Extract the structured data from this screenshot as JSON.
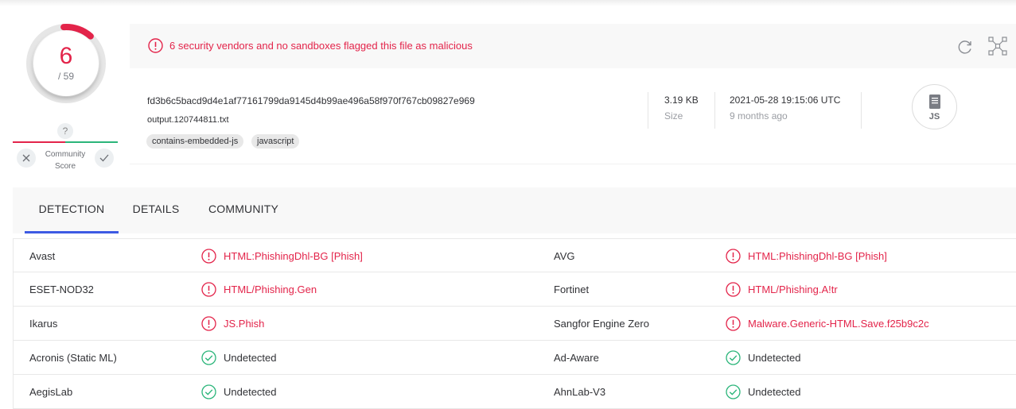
{
  "score": {
    "detections": "6",
    "total": "/ 59"
  },
  "community": {
    "question": "?",
    "label_line1": "Community",
    "label_line2": "Score"
  },
  "alert": {
    "text": "6 security vendors and no sandboxes flagged this file as malicious"
  },
  "file": {
    "hash": "fd3b6c5bacd9d4e1af77161799da9145d4b99ae496a58f970f767cb09827e969",
    "name": "output.120744811.txt",
    "tags": [
      "contains-embedded-js",
      "javascript"
    ],
    "size_value": "3.19 KB",
    "size_label": "Size",
    "date_value": "2021-05-28 19:15:06 UTC",
    "date_relative": "9 months ago",
    "type_label": "JS"
  },
  "tabs": [
    {
      "label": "DETECTION",
      "active": true
    },
    {
      "label": "DETAILS",
      "active": false
    },
    {
      "label": "COMMUNITY",
      "active": false
    }
  ],
  "detections": [
    {
      "left_engine": "Avast",
      "left_result": "HTML:PhishingDhl-BG [Phish]",
      "left_status": "malicious",
      "right_engine": "AVG",
      "right_result": "HTML:PhishingDhl-BG [Phish]",
      "right_status": "malicious"
    },
    {
      "left_engine": "ESET-NOD32",
      "left_result": "HTML/Phishing.Gen",
      "left_status": "malicious",
      "right_engine": "Fortinet",
      "right_result": "HTML/Phishing.A!tr",
      "right_status": "malicious"
    },
    {
      "left_engine": "Ikarus",
      "left_result": "JS.Phish",
      "left_status": "malicious",
      "right_engine": "Sangfor Engine Zero",
      "right_result": "Malware.Generic-HTML.Save.f25b9c2c",
      "right_status": "malicious"
    },
    {
      "left_engine": "Acronis (Static ML)",
      "left_result": "Undetected",
      "left_status": "undetected",
      "right_engine": "Ad-Aware",
      "right_result": "Undetected",
      "right_status": "undetected"
    },
    {
      "left_engine": "AegisLab",
      "left_result": "Undetected",
      "left_status": "undetected",
      "right_engine": "AhnLab-V3",
      "right_result": "Undetected",
      "right_status": "undetected"
    }
  ],
  "colors": {
    "malicious": "#e3244a",
    "clean": "#2bb57a",
    "accent": "#3d5ae3"
  }
}
